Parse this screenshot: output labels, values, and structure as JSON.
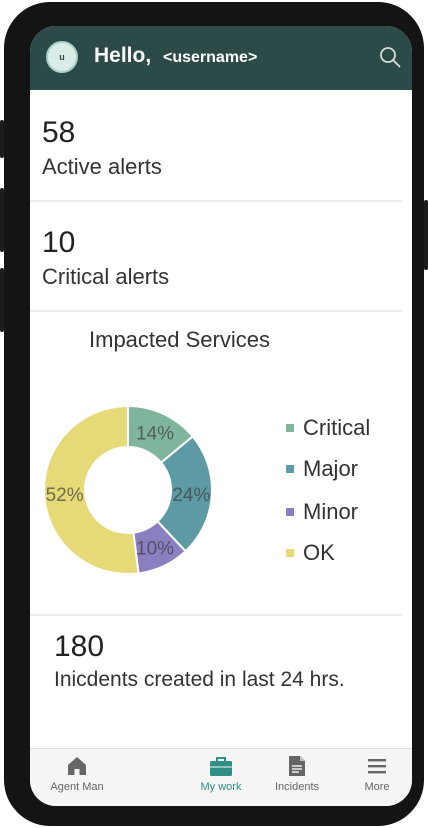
{
  "header": {
    "greeting": "Hello,",
    "username": "<username>",
    "avatar_text": "u",
    "icon": "search-icon",
    "color": "#2c4a47"
  },
  "stats": {
    "active_alerts": {
      "value": "58",
      "label": "Active alerts"
    },
    "critical_alerts": {
      "value": "10",
      "label": "Critical alerts"
    },
    "incidents": {
      "value": "180",
      "label": "Inicdents created in last 24 hrs."
    }
  },
  "impacted_services": {
    "title": "Impacted Services",
    "legend": [
      "Critical",
      "Major",
      "Minor",
      "OK"
    ]
  },
  "chart_data": {
    "type": "pie",
    "title": "Impacted Services",
    "categories": [
      "Critical",
      "Major",
      "Minor",
      "OK"
    ],
    "values": [
      14,
      24,
      10,
      52
    ],
    "labels": [
      "14%",
      "24%",
      "10%",
      "52%"
    ],
    "colors": [
      "#7fb59c",
      "#5e9aa3",
      "#8b7fc1",
      "#e6d977"
    ],
    "donut": true,
    "legend_position": "right"
  },
  "bottom_nav": {
    "items": [
      {
        "label": "Agent Man",
        "icon": "home-icon"
      },
      {
        "label": "My work",
        "icon": "briefcase-icon",
        "active": true
      },
      {
        "label": "Incidents",
        "icon": "document-icon"
      },
      {
        "label": "More",
        "icon": "menu-icon"
      }
    ]
  }
}
